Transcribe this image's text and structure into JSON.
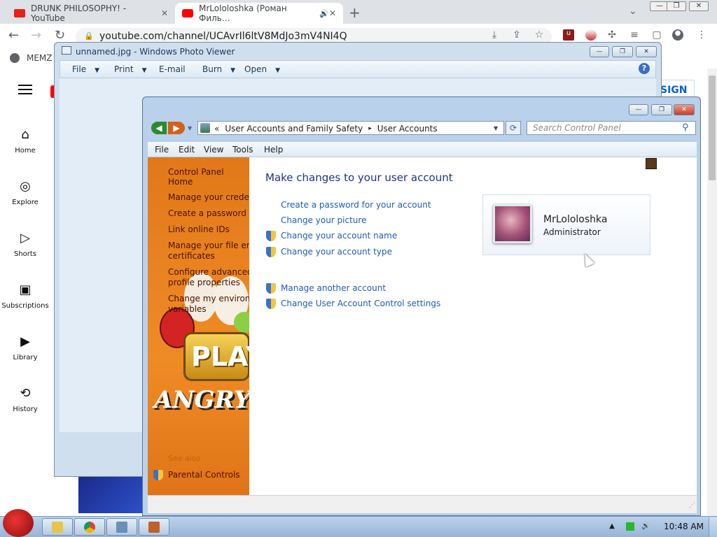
{
  "browser": {
    "tabs": [
      {
        "label": "DRUNK PHILOSOPHY! - YouTube",
        "active": false
      },
      {
        "label": "MrLololoshka (Роман Филь…",
        "active": true,
        "audio": "🔊"
      }
    ],
    "close_glyph": "✕",
    "new_tab_glyph": "+",
    "url": "youtube.com/channel/UCAvrIl6ltV8MdJo3mV4NI4Q",
    "bookmark": "MEMZ",
    "window_controls": {
      "minimize": "—",
      "maximize": "❐",
      "close": "✕"
    }
  },
  "youtube": {
    "sidebar": [
      {
        "label": "Home",
        "icon": "home-icon",
        "glyph": "⌂"
      },
      {
        "label": "Explore",
        "icon": "compass-icon",
        "glyph": "◎"
      },
      {
        "label": "Shorts",
        "icon": "shorts-icon",
        "glyph": "▷"
      },
      {
        "label": "Subscriptions",
        "icon": "subscriptions-icon",
        "glyph": "▣"
      },
      {
        "label": "Library",
        "icon": "library-icon",
        "glyph": "▶"
      },
      {
        "label": "History",
        "icon": "history-icon",
        "glyph": "⟲"
      }
    ],
    "sign_in": "SIGN IN"
  },
  "photo_viewer": {
    "title": "unnamed.jpg - Windows Photo Viewer",
    "menu": [
      "File",
      "Print",
      "E-mail",
      "Burn",
      "Open"
    ],
    "help": "?"
  },
  "control_panel": {
    "breadcrumb": {
      "prefix": "«",
      "level1": "User Accounts and Family Safety",
      "sep": "▸",
      "level2": "User Accounts"
    },
    "search_placeholder": "Search Control Panel",
    "menu": [
      "File",
      "Edit",
      "View",
      "Tools",
      "Help"
    ],
    "left_links": [
      "Control Panel Home",
      "Manage your credenti",
      "Create a password rese",
      "Link online IDs",
      "Manage your file encr",
      "certificates",
      "Configure advanced u",
      "profile properties",
      "Change my environm",
      "variables"
    ],
    "see_also": "See also",
    "parental_controls": "Parental Controls",
    "heading": "Make changes to your user account",
    "tasks": [
      {
        "label": "Create a password for your account",
        "shield": false
      },
      {
        "label": "Change your picture",
        "shield": false
      },
      {
        "label": "Change your account name",
        "shield": true
      },
      {
        "label": "Change your account type",
        "shield": true
      }
    ],
    "tasks2": [
      {
        "label": "Manage another account",
        "shield": true
      },
      {
        "label": "Change User Account Control settings",
        "shield": true
      }
    ],
    "account": {
      "name": "MrLololoshka",
      "role": "Administrator"
    },
    "art": {
      "play": "PLAY",
      "title": "ANGRY BI"
    },
    "window_controls": {
      "minimize": "—",
      "maximize": "❐",
      "close": "✕"
    }
  },
  "taskbar": {
    "time": "10:48 AM"
  },
  "colors": {
    "link": "#1e5bb8",
    "heading": "#1e3287",
    "orange_panel": "#ef8b25",
    "youtube_red": "#ff0000"
  }
}
